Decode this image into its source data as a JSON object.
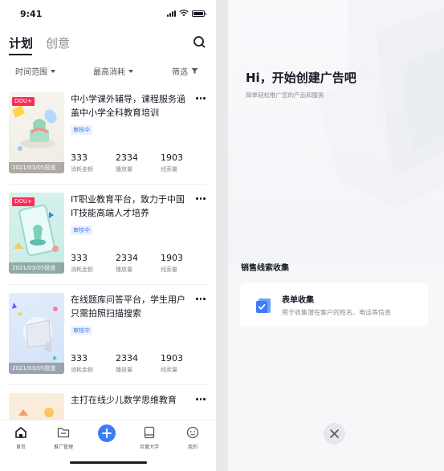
{
  "status_bar": {
    "time": "9:41"
  },
  "tabs": [
    {
      "label": "计划",
      "active": true
    },
    {
      "label": "创意",
      "active": false
    }
  ],
  "filters": [
    {
      "label": "时间范围"
    },
    {
      "label": "最高消耗"
    },
    {
      "label": "筛选"
    }
  ],
  "campaigns": [
    {
      "badge": "DOU+",
      "date": "2021/03/05投放",
      "title": "中小学课外辅导，课程服务涵盖中小学全科教育培训",
      "status": "审核中",
      "stats": [
        {
          "value": "333",
          "label": "消耗金额"
        },
        {
          "value": "2334",
          "label": "播放量"
        },
        {
          "value": "1903",
          "label": "线索量"
        }
      ]
    },
    {
      "badge": "DOU+",
      "date": "2021/03/05投放",
      "title": "IT职业教育平台，致力于中国IT技能高端人才培养",
      "status": "审核中",
      "stats": [
        {
          "value": "333",
          "label": "消耗金额"
        },
        {
          "value": "2334",
          "label": "播放量"
        },
        {
          "value": "1903",
          "label": "线索量"
        }
      ]
    },
    {
      "badge": "",
      "date": "2021/03/05投放",
      "title": "在线题库问答平台，学生用户只需拍照扫描搜索",
      "status": "审核中",
      "stats": [
        {
          "value": "333",
          "label": "消耗金额"
        },
        {
          "value": "2334",
          "label": "播放量"
        },
        {
          "value": "1903",
          "label": "线索量"
        }
      ]
    },
    {
      "badge": "",
      "date": "",
      "title": "主打在线少儿数学思维教育",
      "status": "",
      "stats": []
    }
  ],
  "bottom_nav": [
    {
      "label": "首页",
      "icon": "home-icon"
    },
    {
      "label": "推广管理",
      "icon": "folder-icon"
    },
    {
      "label": "",
      "icon": "add-icon"
    },
    {
      "label": "巨量大学",
      "icon": "book-icon"
    },
    {
      "label": "我的",
      "icon": "profile-icon"
    }
  ],
  "create_panel": {
    "title": "Hi，开始创建广告吧",
    "subtitle": "简单轻松推广您的产品和服务",
    "section_title": "销售线索收集",
    "option": {
      "title": "表单收集",
      "description": "用于收集潜在客户的姓名、电话等信息",
      "icon": "form-icon"
    },
    "close_icon": "close-icon"
  },
  "colors": {
    "accent": "#3c7cf6",
    "badge_red": "#fe2c55",
    "text_primary": "#161823",
    "text_secondary": "#8a8b91"
  }
}
